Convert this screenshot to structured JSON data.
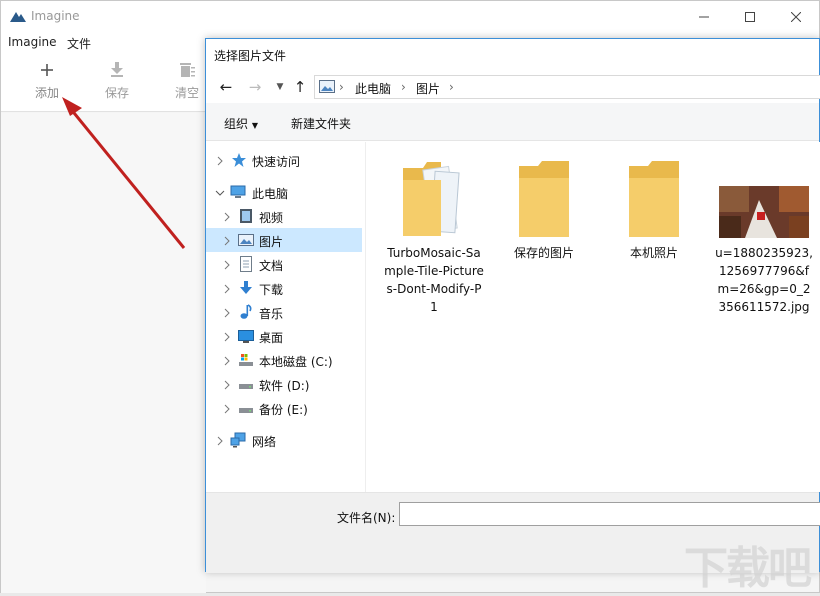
{
  "app": {
    "title": "Imagine"
  },
  "menu": {
    "items": [
      "Imagine",
      "文件"
    ]
  },
  "toolbar": {
    "add_label": "添加",
    "save_label": "保存",
    "clear_label": "清空"
  },
  "dialog": {
    "title": "选择图片文件",
    "breadcrumb": [
      "此电脑",
      "图片"
    ],
    "commands": {
      "organize": "组织",
      "new_folder": "新建文件夹"
    },
    "tree": [
      {
        "label": "快速访问",
        "icon": "quick-access-icon"
      },
      {
        "label": "此电脑",
        "icon": "computer-icon"
      },
      {
        "label": "视频",
        "icon": "video-icon"
      },
      {
        "label": "图片",
        "icon": "pictures-icon",
        "selected": true
      },
      {
        "label": "文档",
        "icon": "document-icon"
      },
      {
        "label": "下载",
        "icon": "download-icon"
      },
      {
        "label": "音乐",
        "icon": "music-icon"
      },
      {
        "label": "桌面",
        "icon": "desktop-icon"
      },
      {
        "label": "本地磁盘 (C:)",
        "icon": "drive-icon"
      },
      {
        "label": "软件 (D:)",
        "icon": "drive-icon"
      },
      {
        "label": "备份 (E:)",
        "icon": "drive-icon"
      },
      {
        "label": "网络",
        "icon": "network-icon"
      }
    ],
    "files": [
      {
        "name": "TurboMosaic-Sample-Tile-Pictures-Dont-Modify-P1",
        "icon": "folder-icon"
      },
      {
        "name": "保存的图片",
        "icon": "folder-icon"
      },
      {
        "name": "本机照片",
        "icon": "folder-icon"
      },
      {
        "name": "u=1880235923,1256977796&fm=26&gp=0_2356611572.jpg",
        "icon": "image-thumbnail"
      }
    ],
    "filename_label": "文件名(N):",
    "filename_value": ""
  },
  "watermark": "下载吧",
  "colors": {
    "accent": "#3c8fd8",
    "selected": "#cce8ff",
    "arrow": "#c0211f",
    "folder": "#f5cd6a"
  }
}
